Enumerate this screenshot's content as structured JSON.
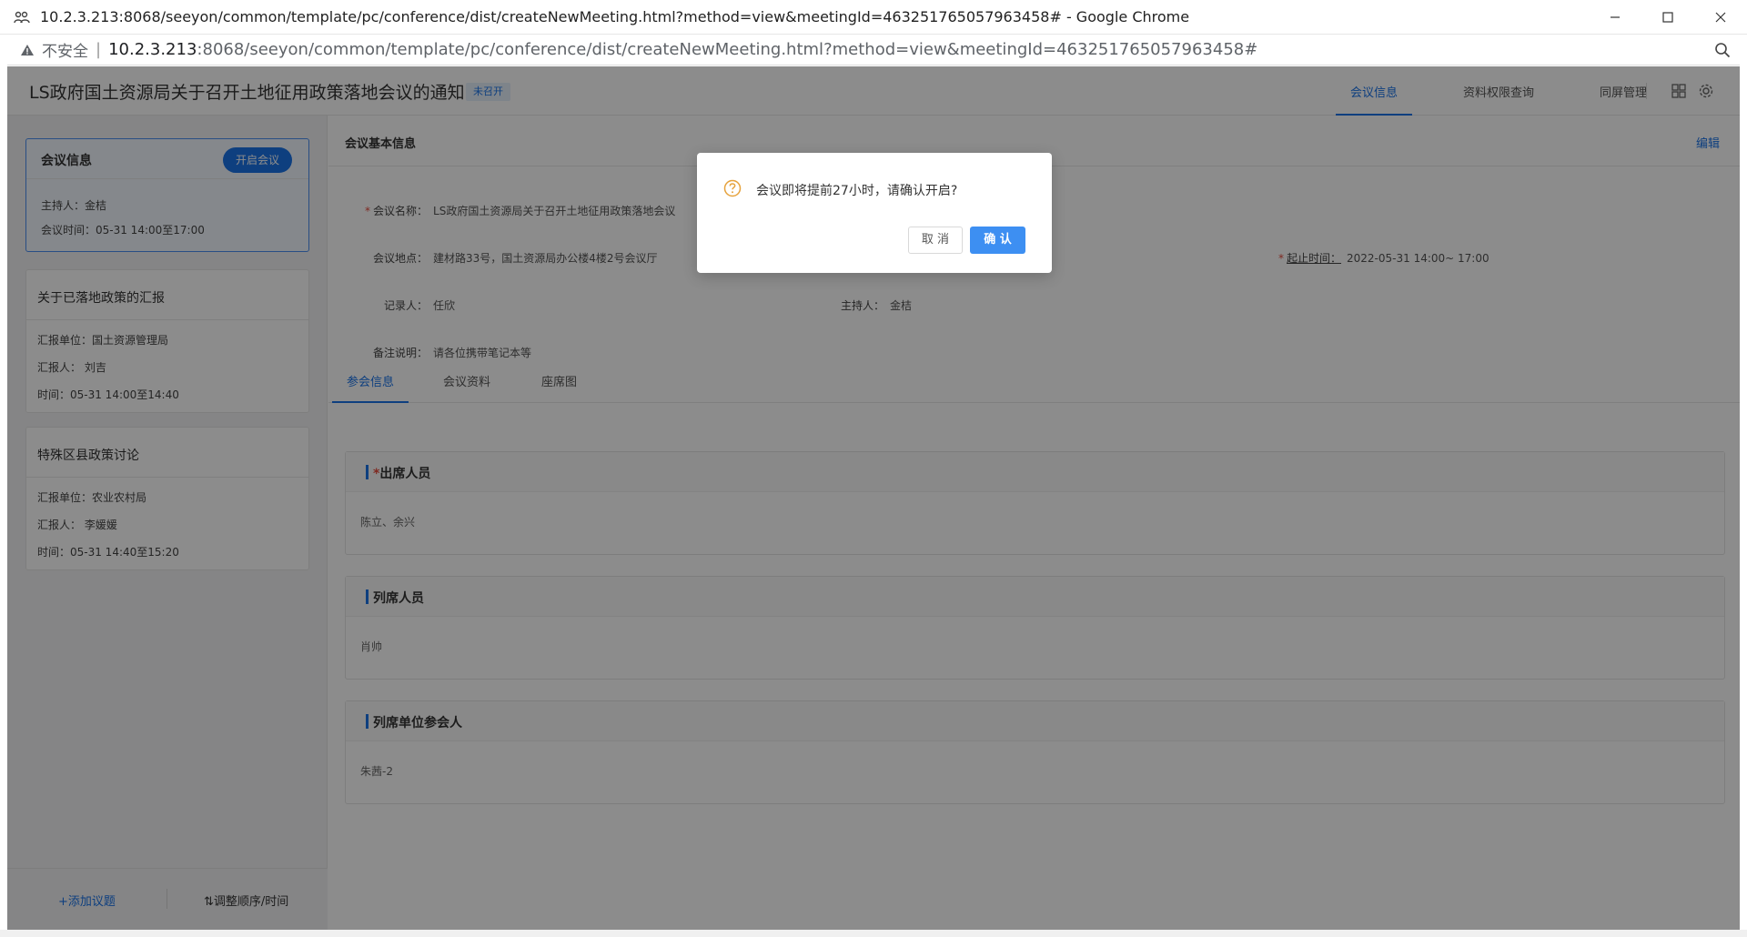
{
  "browser": {
    "window_title": "10.2.3.213:8068/seeyon/common/template/pc/conference/dist/createNewMeeting.html?method=view&meetingId=463251765057963458# - Google Chrome",
    "security_label": "不安全",
    "separator": "|",
    "url_host": "10.2.3.213",
    "url_rest": ":8068/seeyon/common/template/pc/conference/dist/createNewMeeting.html?method=view&meetingId=463251765057963458#"
  },
  "header": {
    "title": "LS政府国土资源局关于召开土地征用政策落地会议的通知",
    "status_badge": "未召开",
    "nav": [
      "会议信息",
      "资料权限查询",
      "同屏管理"
    ]
  },
  "sidebar": {
    "meeting_card": {
      "title": "会议信息",
      "start_button": "开启会议",
      "host": "主持人：金桔",
      "time": "会议时间：05-31 14:00至17:00"
    },
    "topics": [
      {
        "title": "关于已落地政策的汇报",
        "unit": "汇报单位：国土资源管理局",
        "reporter": "汇报人： 刘吉",
        "time": "时间：05-31 14:00至14:40"
      },
      {
        "title": "特殊区县政策讨论",
        "unit": "汇报单位：农业农村局",
        "reporter": "汇报人： 李媛媛",
        "time": "时间：05-31 14:40至15:20"
      }
    ],
    "footer": {
      "add_topic": "+添加议题",
      "adjust_order": "⇅调整顺序/时间"
    }
  },
  "main": {
    "section_title": "会议基本信息",
    "edit_label": "编辑",
    "fields": {
      "name_label": "会议名称：",
      "name_value": "LS政府国土资源局关于召开土地征用政策落地会议",
      "location_label": "会议地点：",
      "location_value": "建材路33号，国土资源局办公楼4楼2号会议厅",
      "time_label": "起止时间：",
      "time_value": "2022-05-31 14:00~ 17:00",
      "recorder_label": "记录人：",
      "recorder_value": "任欣",
      "host_label": "主持人：",
      "host_value": "金桔",
      "notes_label": "备注说明：",
      "notes_value": "请各位携带笔记本等",
      "required_mark": "*"
    },
    "tabs": [
      "参会信息",
      "会议资料",
      "座席图"
    ],
    "panels": [
      {
        "title": "出席人员",
        "required": "*",
        "content": "陈立、余兴"
      },
      {
        "title": "列席人员",
        "required": "",
        "content": "肖帅"
      },
      {
        "title": "列席单位参会人",
        "required": "",
        "content": "朱茜-2"
      }
    ]
  },
  "dialog": {
    "message": "会议即将提前27小时，请确认开启?",
    "cancel": "取 消",
    "confirm": "确 认"
  },
  "colors": {
    "accent": "#1a73e8",
    "confirm_button": "#3d8ff2",
    "question_icon": "#e6a23c",
    "required": "#e74c3c"
  }
}
